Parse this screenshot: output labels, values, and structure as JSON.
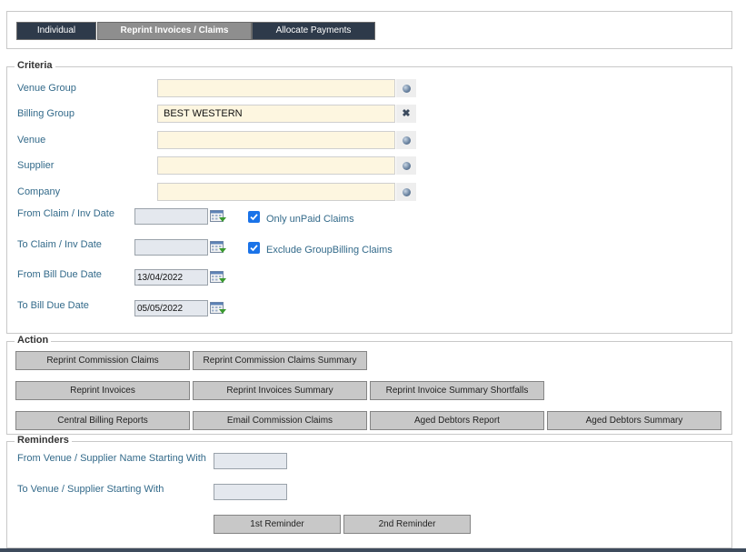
{
  "tabs": {
    "individual": "Individual",
    "reprint": "Reprint Invoices / Claims",
    "allocate": "Allocate Payments"
  },
  "criteria": {
    "legend": "Criteria",
    "venue_group": {
      "label": "Venue Group",
      "value": "",
      "icon": "globe-icon"
    },
    "billing_group": {
      "label": "Billing Group",
      "value": "BEST WESTERN",
      "icon": "clear-icon"
    },
    "venue": {
      "label": "Venue",
      "value": "",
      "icon": "globe-icon"
    },
    "supplier": {
      "label": "Supplier",
      "value": "",
      "icon": "globe-icon"
    },
    "company": {
      "label": "Company",
      "value": "",
      "icon": "globe-icon"
    },
    "from_claim_date": {
      "label": "From Claim / Inv Date",
      "value": ""
    },
    "to_claim_date": {
      "label": "To Claim / Inv Date",
      "value": ""
    },
    "from_bill_due": {
      "label": "From Bill Due Date",
      "value": "13/04/2022"
    },
    "to_bill_due": {
      "label": "To Bill Due Date",
      "value": "05/05/2022"
    },
    "only_unpaid": {
      "label": "Only unPaid Claims",
      "checked": true
    },
    "exclude_group": {
      "label": "Exclude GroupBilling Claims",
      "checked": true
    }
  },
  "action": {
    "legend": "Action",
    "reprint_commission_claims": "Reprint Commission Claims",
    "reprint_commission_claims_summary": "Reprint Commission Claims Summary",
    "reprint_invoices": "Reprint Invoices",
    "reprint_invoices_summary": "Reprint Invoices Summary",
    "reprint_invoice_summary_shortfalls": "Reprint Invoice Summary Shortfalls",
    "central_billing_reports": "Central Billing Reports",
    "email_commission_claims": "Email Commission Claims",
    "aged_debtors_report": "Aged Debtors Report",
    "aged_debtors_summary": "Aged Debtors Summary"
  },
  "reminders": {
    "legend": "Reminders",
    "from_label": "From Venue / Supplier Name Starting With",
    "from_value": "",
    "to_label": "To Venue / Supplier Starting With",
    "to_value": "",
    "first_reminder": "1st Reminder",
    "second_reminder": "2nd Reminder"
  },
  "colors": {
    "dark_tab": "#2e3a4a",
    "active_tab": "#8e8e8e",
    "label": "#336a8a",
    "input_bg": "#fdf6e0",
    "checkbox": "#1a73e8",
    "button": "#c8c8c8"
  }
}
